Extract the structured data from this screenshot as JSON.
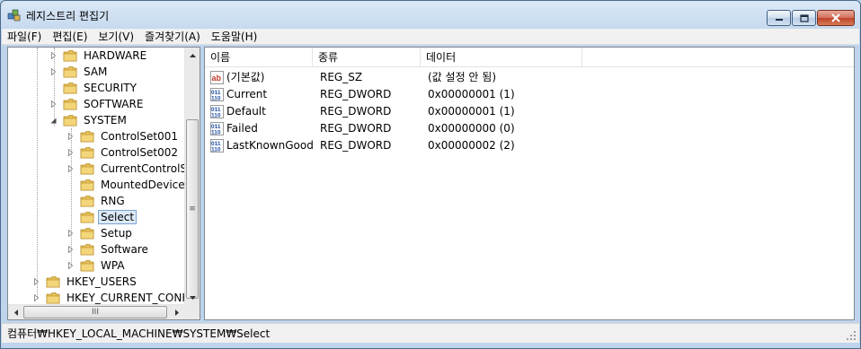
{
  "window": {
    "title": "레지스트리 편집기"
  },
  "menu": [
    "파일(F)",
    "편집(E)",
    "보기(V)",
    "즐겨찾기(A)",
    "도움말(H)"
  ],
  "tree": [
    {
      "label": "HARDWARE",
      "level": 1,
      "expander": "collapsed"
    },
    {
      "label": "SAM",
      "level": 1,
      "expander": "collapsed"
    },
    {
      "label": "SECURITY",
      "level": 1,
      "expander": "none"
    },
    {
      "label": "SOFTWARE",
      "level": 1,
      "expander": "collapsed"
    },
    {
      "label": "SYSTEM",
      "level": 1,
      "expander": "expanded"
    },
    {
      "label": "ControlSet001",
      "level": 2,
      "expander": "collapsed"
    },
    {
      "label": "ControlSet002",
      "level": 2,
      "expander": "collapsed"
    },
    {
      "label": "CurrentControlSet",
      "level": 2,
      "expander": "collapsed"
    },
    {
      "label": "MountedDevices",
      "level": 2,
      "expander": "none"
    },
    {
      "label": "RNG",
      "level": 2,
      "expander": "none"
    },
    {
      "label": "Select",
      "level": 2,
      "expander": "none",
      "selected": true
    },
    {
      "label": "Setup",
      "level": 2,
      "expander": "collapsed"
    },
    {
      "label": "Software",
      "level": 2,
      "expander": "collapsed"
    },
    {
      "label": "WPA",
      "level": 2,
      "expander": "collapsed"
    },
    {
      "label": "HKEY_USERS",
      "level": 0,
      "expander": "collapsed"
    },
    {
      "label": "HKEY_CURRENT_CONFIG",
      "level": 0,
      "expander": "collapsed"
    }
  ],
  "columns": [
    "이름",
    "종류",
    "데이터"
  ],
  "values": [
    {
      "name": "(기본값)",
      "type": "REG_SZ",
      "data": "(값 설정 안 됨)",
      "icon": "string-value-icon"
    },
    {
      "name": "Current",
      "type": "REG_DWORD",
      "data": "0x00000001 (1)",
      "icon": "binary-value-icon"
    },
    {
      "name": "Default",
      "type": "REG_DWORD",
      "data": "0x00000001 (1)",
      "icon": "binary-value-icon"
    },
    {
      "name": "Failed",
      "type": "REG_DWORD",
      "data": "0x00000000 (0)",
      "icon": "binary-value-icon"
    },
    {
      "name": "LastKnownGood",
      "type": "REG_DWORD",
      "data": "0x00000002 (2)",
      "icon": "binary-value-icon"
    }
  ],
  "scroll": {
    "hscroll_glyph": "III",
    "vscroll_glyph": "≡"
  },
  "status": {
    "path": "컴퓨터₩HKEY_LOCAL_MACHINE₩SYSTEM₩Select"
  },
  "colors": {
    "folder": "#e8c25a",
    "selection": "#dceaf7",
    "titlebar": "#c7daef"
  }
}
